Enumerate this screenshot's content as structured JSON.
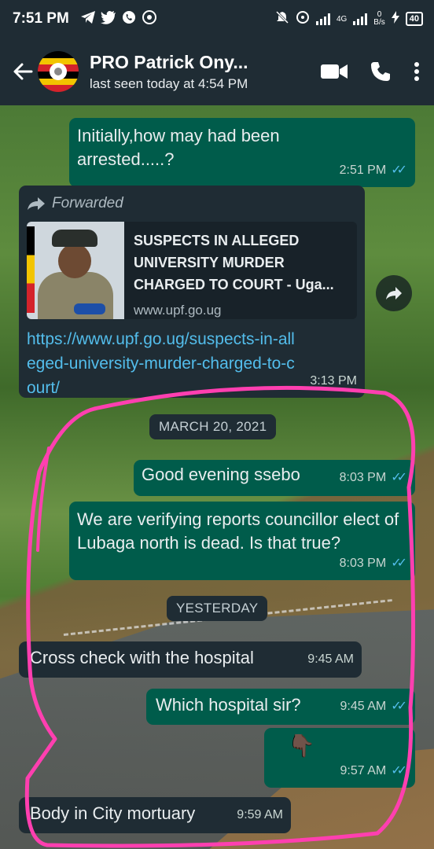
{
  "status_bar": {
    "time": "7:51 PM",
    "network_type": "4G",
    "net_speed_value": "0",
    "net_speed_unit": "B/s",
    "battery": "40"
  },
  "header": {
    "contact_name": "PRO Patrick Ony...",
    "last_seen": "last seen today at 4:54 PM"
  },
  "messages": [
    {
      "type": "out",
      "text": "Initially,how may had been arrested.....?",
      "time": "2:51 PM",
      "ticks": "✓✓"
    },
    {
      "type": "in",
      "forwarded_label": "Forwarded",
      "preview_title": "SUSPECTS IN ALLEGED UNIVERSITY MURDER CHARGED TO COURT - Uga...",
      "preview_domain": "www.upf.go.ug",
      "link": "https://www.upf.go.ug/suspects-in-alleged-university-murder-charged-to-court/",
      "time": "3:13 PM"
    },
    {
      "type": "date",
      "text": "MARCH 20, 2021"
    },
    {
      "type": "out",
      "text": "Good evening ssebo",
      "time": "8:03 PM",
      "ticks": "✓✓"
    },
    {
      "type": "out",
      "text": "We are verifying reports councillor elect of Lubaga north is dead. Is that true?",
      "time": "8:03 PM",
      "ticks": "✓✓"
    },
    {
      "type": "date",
      "text": "YESTERDAY"
    },
    {
      "type": "in",
      "text": "Cross check with the hospital",
      "time": "9:45 AM"
    },
    {
      "type": "out",
      "text": "Which hospital sir?",
      "time": "9:45 AM",
      "ticks": "✓✓"
    },
    {
      "type": "out",
      "text": "👇🏿",
      "time": "9:57 AM",
      "ticks": "✓✓"
    },
    {
      "type": "in",
      "text": "Body in City mortuary",
      "time": "9:59 AM"
    }
  ],
  "colors": {
    "header_bg": "#1f2c34",
    "outgoing_bubble": "#005c4b",
    "incoming_bubble": "#1f2c34",
    "read_ticks": "#53bdeb",
    "annotation_stroke": "#ff3fb0"
  },
  "icons": {
    "back": "back-arrow-icon",
    "video": "video-call-icon",
    "call": "phone-icon",
    "menu": "more-vert-icon",
    "forward": "forward-arrow-icon",
    "share": "share-icon"
  }
}
